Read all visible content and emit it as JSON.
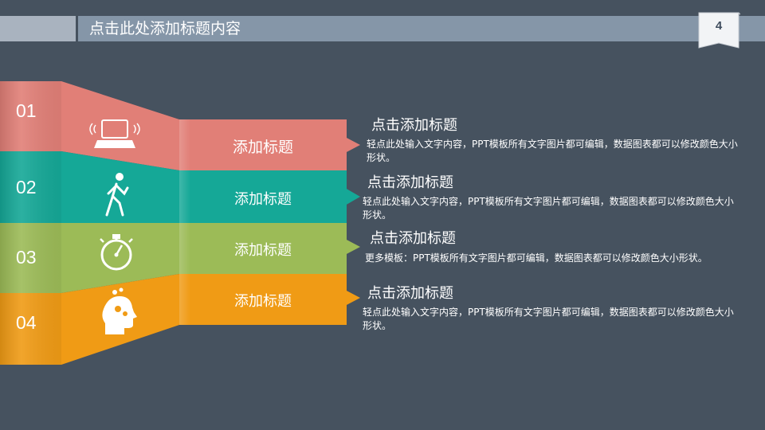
{
  "header": {
    "title": "点击此处添加标题内容",
    "page_number": "4"
  },
  "colors": {
    "background": "#46525F",
    "red": "#E17F77",
    "teal": "#15A897",
    "green": "#9CBB57",
    "orange": "#F09B15"
  },
  "rows": [
    {
      "number": "01",
      "label": "添加标题",
      "icon": "laptop-icon",
      "title": "点击添加标题",
      "desc": "轻点此处输入文字内容，PPT模板所有文字图片都可编辑，数据图表都可以修改颜色大小形状。"
    },
    {
      "number": "02",
      "label": "添加标题",
      "icon": "walking-person-icon",
      "title": "点击添加标题",
      "desc": "轻点此处输入文字内容，PPT模板所有文字图片都可编辑，数据图表都可以修改颜色大小形状。"
    },
    {
      "number": "03",
      "label": "添加标题",
      "icon": "stopwatch-icon",
      "title": "点击添加标题",
      "desc": "更多模板：PPT模板所有文字图片都可编辑，数据图表都可以修改颜色大小形状。"
    },
    {
      "number": "04",
      "label": "添加标题",
      "icon": "head-gears-icon",
      "title": "点击添加标题",
      "desc": "轻点此处输入文字内容，PPT模板所有文字图片都可编辑，数据图表都可以修改颜色大小形状。"
    }
  ]
}
